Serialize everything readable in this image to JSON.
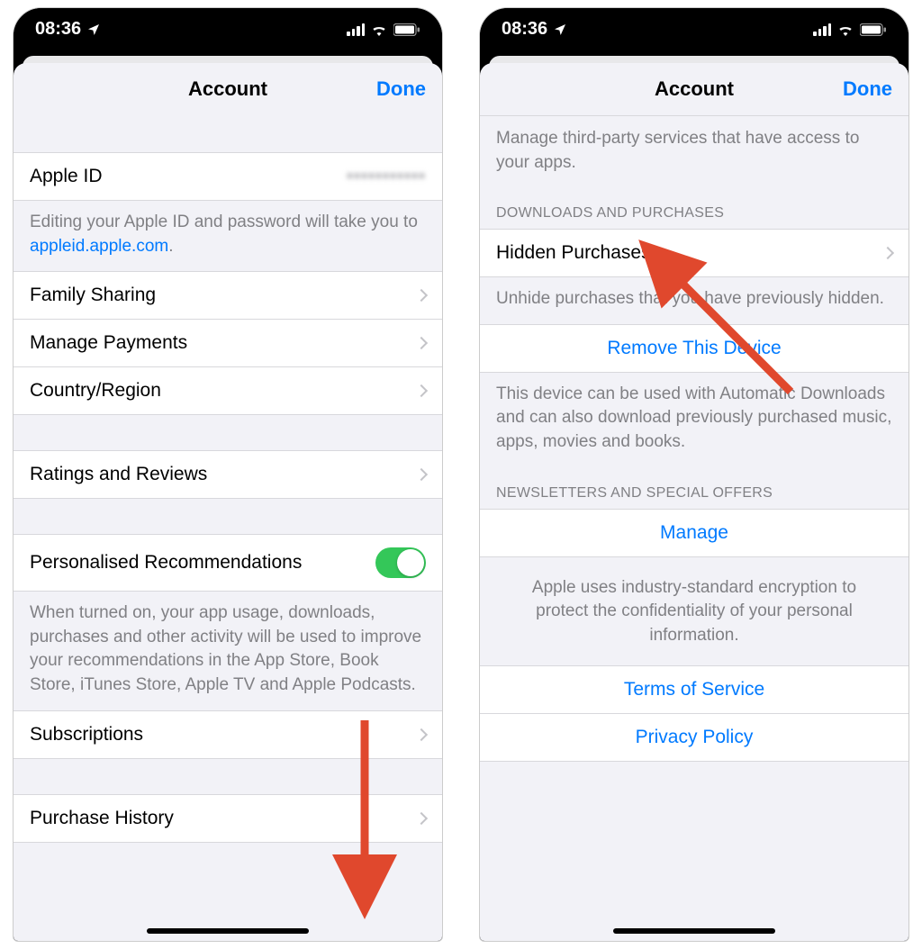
{
  "statusbar": {
    "time": "08:36"
  },
  "nav": {
    "title": "Account",
    "done": "Done"
  },
  "left": {
    "apple_id_label": "Apple ID",
    "apple_id_value": "•••••••••••",
    "apple_id_footer_pre": "Editing your Apple ID and password will take you to ",
    "apple_id_footer_link": "appleid.apple.com",
    "apple_id_footer_post": ".",
    "family_sharing": "Family Sharing",
    "manage_payments": "Manage Payments",
    "country_region": "Country/Region",
    "ratings_reviews": "Ratings and Reviews",
    "pers_rec_label": "Personalised Recommendations",
    "pers_rec_footer": "When turned on, your app usage, downloads, purchases and other activity will be used to improve your recommendations in the App Store, Book Store, iTunes Store, Apple TV and Apple Podcasts.",
    "subscriptions": "Subscriptions",
    "purchase_history": "Purchase History"
  },
  "right": {
    "apps_footer": "Manage third-party services that have access to your apps.",
    "section_downloads": "DOWNLOADS AND PURCHASES",
    "hidden_purchases": "Hidden Purchases",
    "hidden_footer": "Unhide purchases that you have previously hidden.",
    "remove_device": "Remove This Device",
    "remove_footer": "This device can be used with Automatic Downloads and can also download previously purchased music, apps, movies and books.",
    "section_newsletters": "NEWSLETTERS AND SPECIAL OFFERS",
    "manage": "Manage",
    "encryption": "Apple uses industry-standard encryption to protect the confidentiality of your personal information.",
    "terms": "Terms of Service",
    "privacy": "Privacy Policy"
  }
}
